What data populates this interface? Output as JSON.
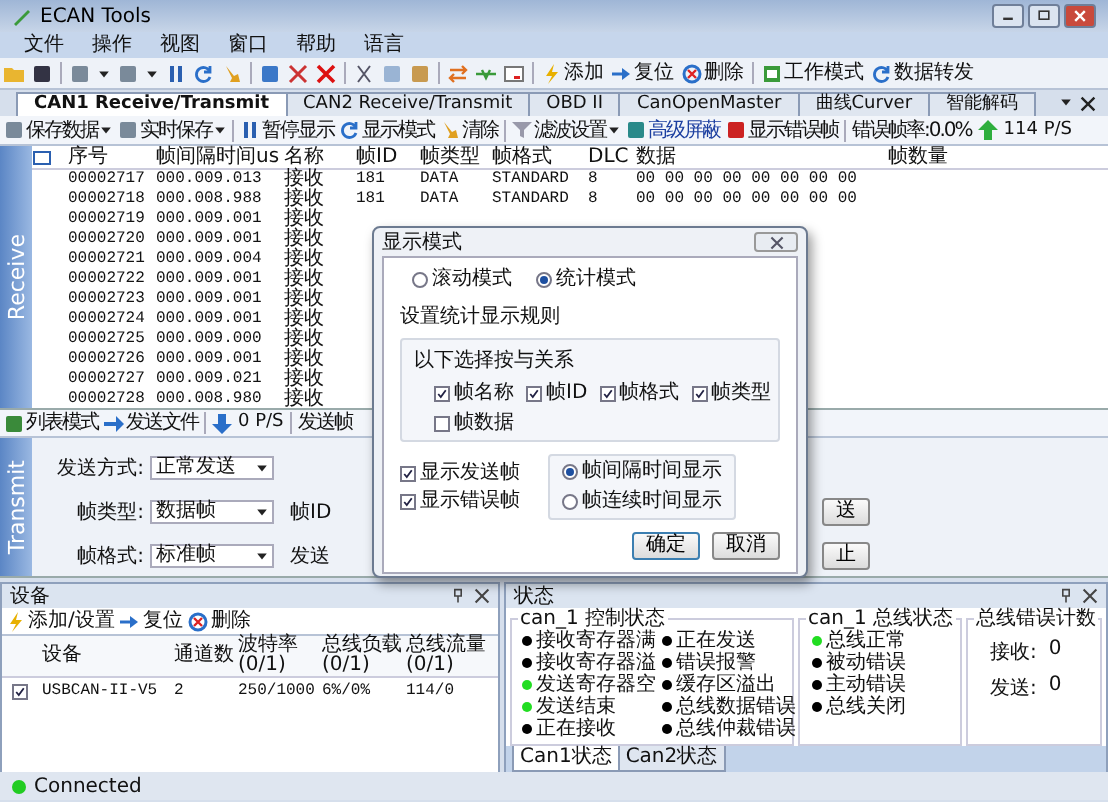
{
  "window": {
    "title": "ECAN Tools"
  },
  "menu": [
    "文件",
    "操作",
    "视图",
    "窗口",
    "帮助",
    "语言"
  ],
  "toolbar": [
    {
      "label": "添加"
    },
    {
      "label": "复位"
    },
    {
      "label": "删除"
    },
    {
      "label": "工作模式"
    },
    {
      "label": "数据转发"
    }
  ],
  "tabs": [
    {
      "label": "CAN1 Receive/Transmit",
      "selected": true
    },
    {
      "label": "CAN2 Receive/Transmit",
      "selected": false
    },
    {
      "label": "OBD II",
      "selected": false
    },
    {
      "label": "CanOpenMaster",
      "selected": false
    },
    {
      "label": "曲线Curver",
      "selected": false
    },
    {
      "label": "智能解码",
      "selected": false
    }
  ],
  "receive_toolbar": {
    "save": "保存数据",
    "realtime_save": "实时保存",
    "pause": "暂停显示",
    "display_mode": "显示模式",
    "clear": "清除",
    "filter": "滤波设置",
    "advanced_mask": "高级屏蔽",
    "show_errors": "显示错误帧",
    "error_rate": "错误帧率:0.0%",
    "rate": "114 P/S"
  },
  "receive": {
    "label": "Receive",
    "columns": [
      "序号",
      "帧间隔时间us",
      "名称",
      "帧ID",
      "帧类型",
      "帧格式",
      "DLC",
      "数据",
      "帧数量"
    ],
    "rows": [
      {
        "cells": [
          "00002717",
          "000.009.013",
          "接收",
          "181",
          "DATA",
          "STANDARD",
          "8",
          "00 00 00 00 00 00 00 00"
        ]
      },
      {
        "cells": [
          "00002718",
          "000.008.988",
          "接收",
          "181",
          "DATA",
          "STANDARD",
          "8",
          "00 00 00 00 00 00 00 00"
        ]
      },
      {
        "cells": [
          "00002719",
          "000.009.001",
          "接收"
        ]
      },
      {
        "cells": [
          "00002720",
          "000.009.001",
          "接收"
        ]
      },
      {
        "cells": [
          "00002721",
          "000.009.004",
          "接收"
        ]
      },
      {
        "cells": [
          "00002722",
          "000.009.001",
          "接收"
        ]
      },
      {
        "cells": [
          "00002723",
          "000.009.001",
          "接收"
        ]
      },
      {
        "cells": [
          "00002724",
          "000.009.001",
          "接收"
        ]
      },
      {
        "cells": [
          "00002725",
          "000.009.000",
          "接收"
        ]
      },
      {
        "cells": [
          "00002726",
          "000.009.001",
          "接收"
        ]
      },
      {
        "cells": [
          "00002727",
          "000.009.021",
          "接收"
        ]
      },
      {
        "cells": [
          "00002728",
          "000.008.980",
          "接收"
        ]
      }
    ]
  },
  "transmit_toolbar": {
    "list_mode": "列表模式",
    "send_file": "发送文件",
    "rate": "0 P/S",
    "frame_count": "发送帧"
  },
  "transmit": {
    "label": "Transmit",
    "fields": [
      {
        "label": "发送方式:",
        "value": "正常发送"
      },
      {
        "label": "帧类型:",
        "value": "数据帧",
        "side_label": "帧ID",
        "button": "送"
      },
      {
        "label": "帧格式:",
        "value": "标准帧",
        "side_label": "发送",
        "button": "止"
      }
    ]
  },
  "dialog": {
    "title": "显示模式",
    "modes": [
      {
        "label": "滚动模式",
        "selected": false
      },
      {
        "label": "统计模式",
        "selected": true
      }
    ],
    "group_title": "设置统计显示规则",
    "rule_label": "以下选择按与关系",
    "rules": [
      {
        "label": "帧名称",
        "checked": true
      },
      {
        "label": "帧ID",
        "checked": true
      },
      {
        "label": "帧格式",
        "checked": true
      },
      {
        "label": "帧类型",
        "checked": true
      },
      {
        "label": "帧数据",
        "checked": false
      }
    ],
    "options": [
      {
        "label": "显示发送帧",
        "checked": true
      },
      {
        "label": "显示错误帧",
        "checked": true
      }
    ],
    "time_modes": [
      {
        "label": "帧间隔时间显示",
        "selected": true
      },
      {
        "label": "帧连续时间显示",
        "selected": false
      }
    ],
    "ok": "确定",
    "cancel": "取消"
  },
  "devices": {
    "title": "设备",
    "toolbar": [
      "添加/设置",
      "复位",
      "删除"
    ],
    "columns": [
      "设备",
      "通道数",
      "波特率 (0/1)",
      "总线负载 (0/1)",
      "总线流量 (0/1)"
    ],
    "rows": [
      {
        "checked": true,
        "cells": [
          "USBCAN-II-V5",
          "2",
          "250/1000",
          "6%/0%",
          "114/0"
        ]
      }
    ]
  },
  "status": {
    "title": "状态",
    "control_title": "can_1 控制状态",
    "control_items": [
      {
        "label": "接收寄存器满",
        "color": "#000000"
      },
      {
        "label": "接收寄存器溢",
        "color": "#000000"
      },
      {
        "label": "发送寄存器空",
        "color": "#22dd22"
      },
      {
        "label": "发送结束",
        "color": "#22dd22"
      },
      {
        "label": "正在接收",
        "color": "#000000"
      },
      {
        "label": "正在发送",
        "color": "#000000"
      },
      {
        "label": "错误报警",
        "color": "#000000"
      },
      {
        "label": "缓存区溢出",
        "color": "#000000"
      },
      {
        "label": "总线数据错误",
        "color": "#000000"
      },
      {
        "label": "总线仲裁错误",
        "color": "#000000"
      }
    ],
    "bus_title": "can_1 总线状态",
    "bus_items": [
      {
        "label": "总线正常",
        "color": "#22dd22"
      },
      {
        "label": "被动错误",
        "color": "#000000"
      },
      {
        "label": "主动错误",
        "color": "#000000"
      },
      {
        "label": "总线关闭",
        "color": "#000000"
      }
    ],
    "counter_title": "总线错误计数",
    "counters": [
      {
        "label": "接收:",
        "value": "0"
      },
      {
        "label": "发送:",
        "value": "0"
      }
    ],
    "tabs": [
      {
        "label": "Can1状态",
        "selected": true
      },
      {
        "label": "Can2状态",
        "selected": false
      }
    ]
  },
  "status_bar": {
    "text": "Connected",
    "connected": true
  }
}
